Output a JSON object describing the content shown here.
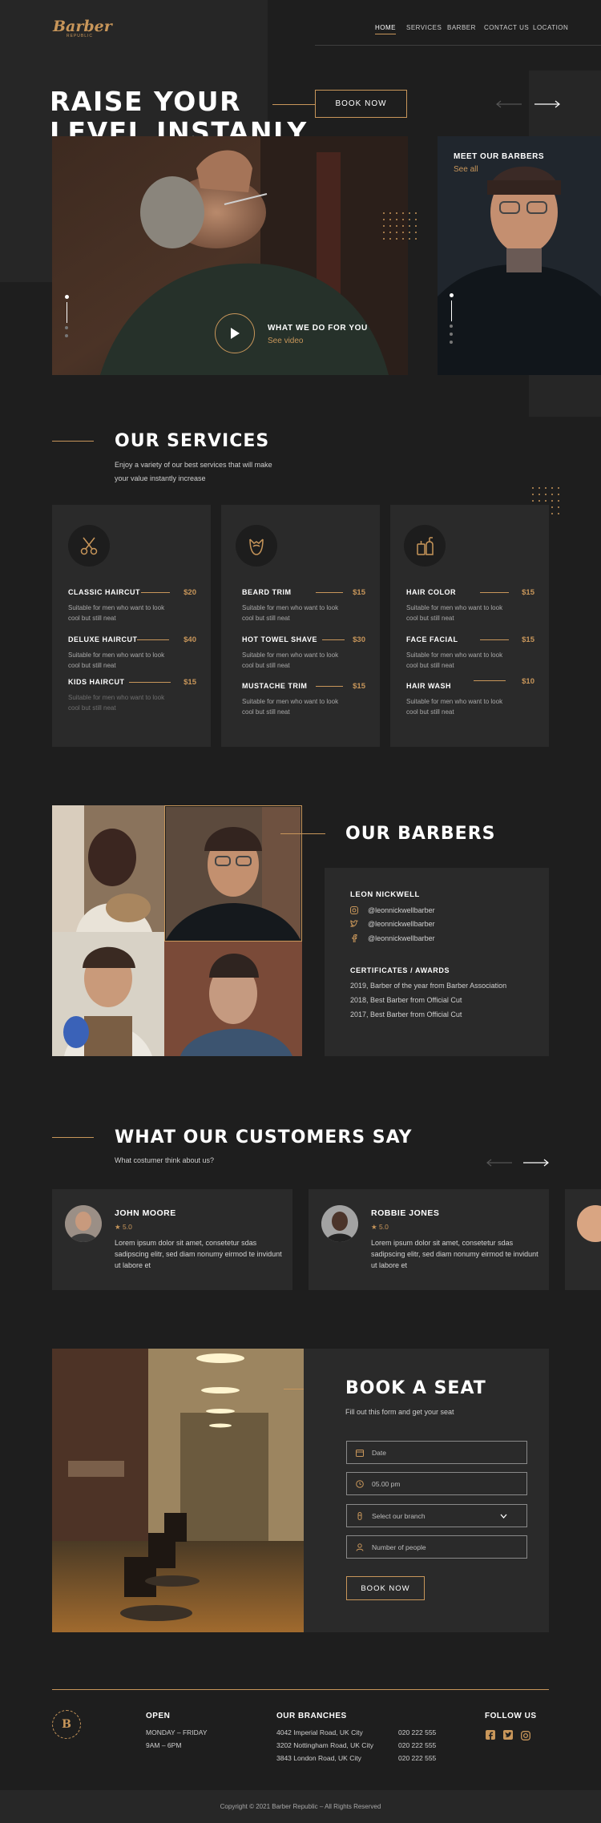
{
  "brand": {
    "name": "Barber",
    "tagline": "REPUBLIC"
  },
  "nav": {
    "items": [
      "HOME",
      "SERVICES",
      "BARBER",
      "CONTACT US",
      "LOCATION"
    ]
  },
  "hero": {
    "title_line1": "RAISE YOUR",
    "title_line2": "LEVEL INSTANLY",
    "book_button": "BOOK NOW",
    "video_title": "WHAT WE DO FOR YOU",
    "video_link": "See video",
    "side_title": "MEET OUR BARBERS",
    "side_link": "See all"
  },
  "services": {
    "title": "OUR SERVICES",
    "subtitle_line1": "Enjoy a variety of our best services that will make",
    "subtitle_line2": "your value instantly increase",
    "columns": [
      {
        "icon": "scissors-icon",
        "items": [
          {
            "name": "CLASSIC HAIRCUT",
            "price": "$20",
            "desc": "Suitable for men who want to look cool but still neat"
          },
          {
            "name": "DELUXE HAIRCUT",
            "price": "$40",
            "desc": "Suitable for men who want to look cool but still neat"
          },
          {
            "name": "KIDS HAIRCUT",
            "price": "$15",
            "desc": "Suitable for men who want to look cool but still neat"
          }
        ]
      },
      {
        "icon": "beard-icon",
        "items": [
          {
            "name": "BEARD TRIM",
            "price": "$15",
            "desc": "Suitable for men who want to look cool but still neat"
          },
          {
            "name": "HOT TOWEL SHAVE",
            "price": "$30",
            "desc": "Suitable for men who want to look cool but still neat"
          },
          {
            "name": "MUSTACHE TRIM",
            "price": "$15",
            "desc": "Suitable for men who want to look cool but still neat"
          }
        ]
      },
      {
        "icon": "hair-products-icon",
        "items": [
          {
            "name": "HAIR COLOR",
            "price": "$15",
            "desc": "Suitable for men who want to look cool but still neat"
          },
          {
            "name": "FACE FACIAL",
            "price": "$15",
            "desc": "Suitable for men who want to look cool but still neat"
          },
          {
            "name": "HAIR WASH",
            "price": "$10",
            "desc": "Suitable for men who want to look cool but still neat"
          }
        ]
      }
    ]
  },
  "barbers": {
    "title": "OUR BARBERS",
    "name": "LEON NICKWELL",
    "socials": [
      {
        "icon": "instagram-icon",
        "handle": "@leonnickwellbarber"
      },
      {
        "icon": "twitter-icon",
        "handle": "@leonnickwellbarber"
      },
      {
        "icon": "facebook-icon",
        "handle": "@leonnickwellbarber"
      }
    ],
    "awards_title": "CERTIFICATES / AWARDS",
    "awards": [
      "2019, Barber of the year from Barber Association",
      "2018, Best Barber from Official Cut",
      "2017, Best Barber from Official Cut"
    ]
  },
  "testimonials": {
    "title": "WHAT OUR CUSTOMERS SAY",
    "subtitle": "What costumer think about us?",
    "reviews": [
      {
        "name": "JOHN MOORE",
        "rating": "★ 5.0",
        "text": "Lorem ipsum dolor sit amet, consetetur sdas sadipscing elitr, sed diam nonumy eirmod te invidunt ut labore et"
      },
      {
        "name": "ROBBIE JONES",
        "rating": "★ 5.0",
        "text": "Lorem ipsum dolor sit amet, consetetur sdas sadipscing elitr, sed diam nonumy eirmod te invidunt ut labore et"
      }
    ]
  },
  "booking": {
    "title": "BOOK A SEAT",
    "subtitle": "Fill out this form and get your seat",
    "date_placeholder": "Date",
    "time_value": "05.00 pm",
    "branch_placeholder": "Select our branch",
    "people_placeholder": "Number of people",
    "submit": "BOOK NOW"
  },
  "footer": {
    "open_title": "OPEN",
    "open_days": "MONDAY – FRIDAY",
    "open_hours": "9AM – 6PM",
    "branches_title": "OUR BRANCHES",
    "branches": [
      {
        "address": "4042 Imperial Road, UK City",
        "phone": "020 222 555"
      },
      {
        "address": "3202 Nottingham Road, UK City",
        "phone": "020 222 555"
      },
      {
        "address": "3843 London Road, UK City",
        "phone": "020 222 555"
      }
    ],
    "follow_title": "FOLLOW US",
    "copyright": "Copyright © 2021 Barber Republic – All Rights Reserved"
  },
  "colors": {
    "accent": "#c8965a",
    "background": "#1e1e1e",
    "panel": "#2a2a2a"
  }
}
